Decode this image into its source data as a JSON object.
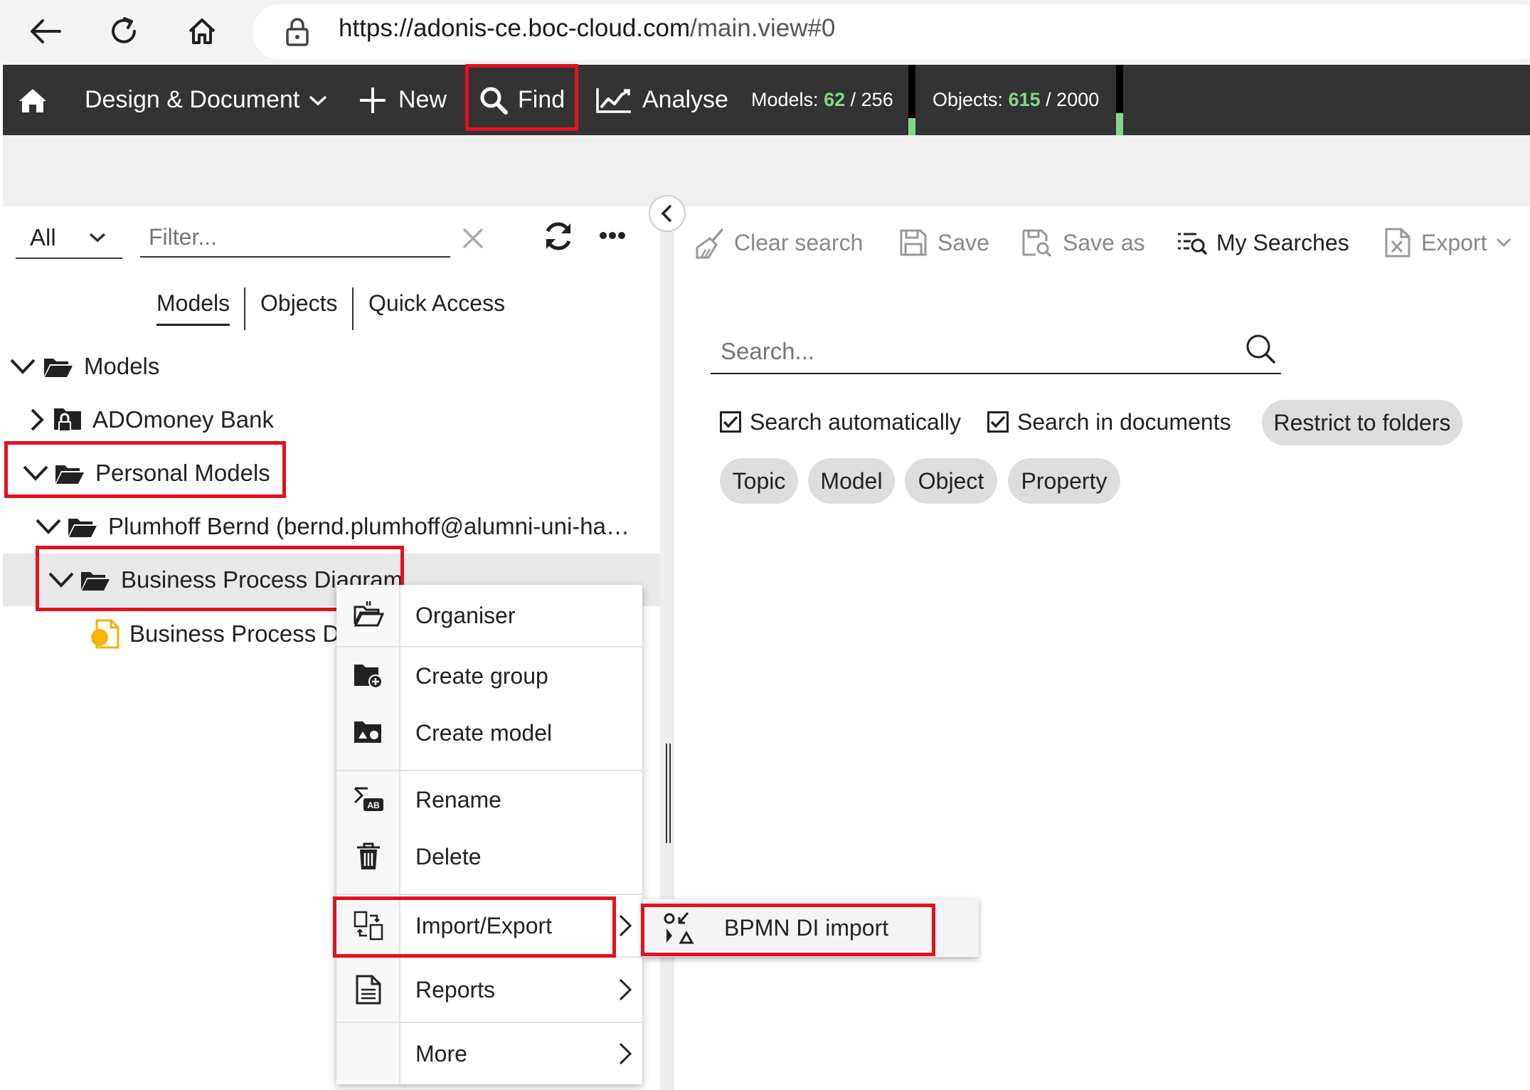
{
  "browser": {
    "url_host": "https://adonis-ce.boc-cloud.com",
    "url_path": "/main.view#0"
  },
  "toolbar": {
    "design_document": "Design & Document",
    "new": "New",
    "find": "Find",
    "analyse": "Analyse",
    "models_label": "Models:",
    "models_used": "62",
    "models_sep": "/",
    "models_total": "256",
    "objects_label": "Objects:",
    "objects_used": "615",
    "objects_sep": "/",
    "objects_total": "2000"
  },
  "left_panel": {
    "scope_select": "All",
    "filter_placeholder": "Filter...",
    "tabs": [
      "Models",
      "Objects",
      "Quick Access"
    ],
    "tree": [
      "Models",
      "ADOmoney Bank",
      "Personal Models",
      "Plumhoff Bernd (bernd.plumhoff@alumni-uni-ha…",
      "Business Process Diagram",
      "Business Process D"
    ]
  },
  "right_panel": {
    "clear_search": "Clear search",
    "save": "Save",
    "save_as": "Save as",
    "my_searches": "My Searches",
    "export": "Export",
    "search_placeholder": "Search...",
    "search_automatically": "Search automatically",
    "search_in_documents": "Search in documents",
    "restrict_to_folders": "Restrict to folders",
    "chips": [
      "Topic",
      "Model",
      "Object",
      "Property"
    ]
  },
  "context_menu": {
    "items": [
      "Organiser",
      "Create group",
      "Create model",
      "Rename",
      "Delete",
      "Import/Export",
      "Reports",
      "More"
    ]
  },
  "submenu": {
    "bpmn_di_import": "BPMN DI import"
  },
  "colors": {
    "toolbar_bg": "#333333",
    "highlight_red": "#e3121f",
    "counter_green": "#7fd98a"
  }
}
